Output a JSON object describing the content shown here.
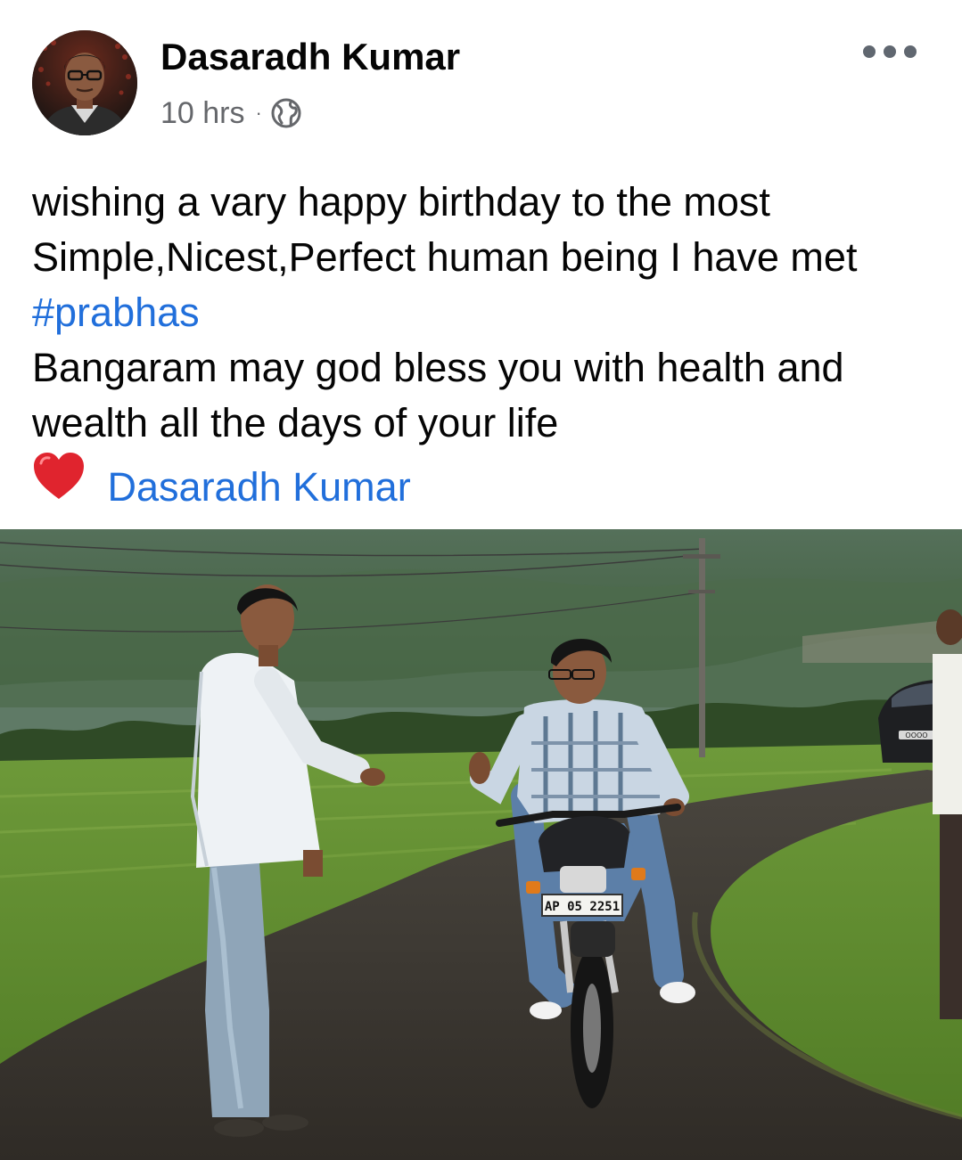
{
  "author": {
    "name": "Dasaradh Kumar"
  },
  "meta": {
    "time": "10 hrs",
    "separator": "·",
    "audience_icon": "globe-icon"
  },
  "menu": {
    "icon": "more-dots-icon"
  },
  "post": {
    "line1": "wishing a vary happy birthday to the most",
    "line2": "Simple,Nicest,Perfect human being I have met",
    "hashtag": "#prabhas",
    "line3": "Bangaram may god bless you with health and",
    "line4": "wealth all the days of your life",
    "heart_icon": "red-heart-icon",
    "mention": "Dasaradh Kumar"
  },
  "photo": {
    "plate_text": "AP 05 2251",
    "car_badge": "OOOO"
  },
  "colors": {
    "link": "#216fdb",
    "secondary": "#65676b",
    "heart": "#e0242e"
  }
}
